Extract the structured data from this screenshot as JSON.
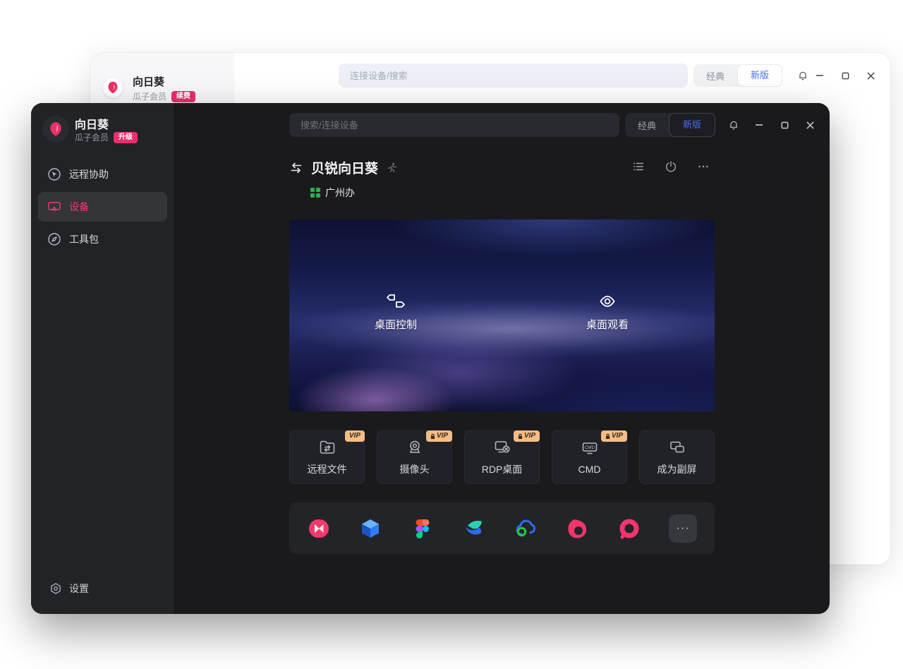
{
  "colors": {
    "accent_pink": "#ed2e6d",
    "accent_blue": "#4a6df5",
    "vip_badge_bg": "#f3bd85",
    "online_green": "#24b24b",
    "dark_bg": "#1a1a1d",
    "sidebar_bg": "#222327"
  },
  "back_window": {
    "app_title": "向日葵",
    "membership": "瓜子会员",
    "renew_badge": "续费",
    "search_placeholder": "连接设备/搜索",
    "toggle": {
      "classic": "经典",
      "new": "新版"
    }
  },
  "front_window": {
    "sidebar": {
      "app_title": "向日葵",
      "membership": "瓜子会员",
      "upgrade_badge": "升级",
      "items": [
        {
          "label": "远程协助",
          "icon": "remote-assist-icon",
          "active": false
        },
        {
          "label": "设备",
          "icon": "device-icon",
          "active": true
        },
        {
          "label": "工具包",
          "icon": "toolkit-icon",
          "active": false
        }
      ],
      "settings_label": "设置"
    },
    "topbar": {
      "search_placeholder": "搜索/连接设备",
      "toggle": {
        "classic": "经典",
        "new": "新版"
      }
    },
    "device": {
      "title": "贝锐向日葵",
      "status_icon": "running-icon",
      "group": "广州办",
      "group_icon": "online-grid-icon",
      "header_icons": [
        "list-view-icon",
        "power-icon",
        "more-ellipsis-icon"
      ],
      "primary_actions": [
        {
          "label": "桌面控制",
          "icon": "swap-arrows-icon"
        },
        {
          "label": "桌面观看",
          "icon": "eye-icon"
        }
      ],
      "secondary_actions": [
        {
          "label": "远程文件",
          "icon": "remote-file-icon",
          "badge": "VIP",
          "locked": false
        },
        {
          "label": "摄像头",
          "icon": "camera-icon",
          "badge": "VIP",
          "locked": true
        },
        {
          "label": "RDP桌面",
          "icon": "rdp-desktop-icon",
          "badge": "VIP",
          "locked": true
        },
        {
          "label": "CMD",
          "icon": "cmd-icon",
          "icon_text": "CMD",
          "badge": "VIP",
          "locked": true
        },
        {
          "label": "成为副屏",
          "icon": "second-screen-icon",
          "badge": null,
          "locked": false
        }
      ],
      "app_shortcuts": [
        "sunflower-remote-app-icon",
        "blue-cube-app-icon",
        "figma-app-icon",
        "dandelion-app-icon",
        "cloud-app-icon",
        "oray-drop-app-icon",
        "oray-ring-app-icon"
      ],
      "more_apps_glyph": "···"
    }
  }
}
